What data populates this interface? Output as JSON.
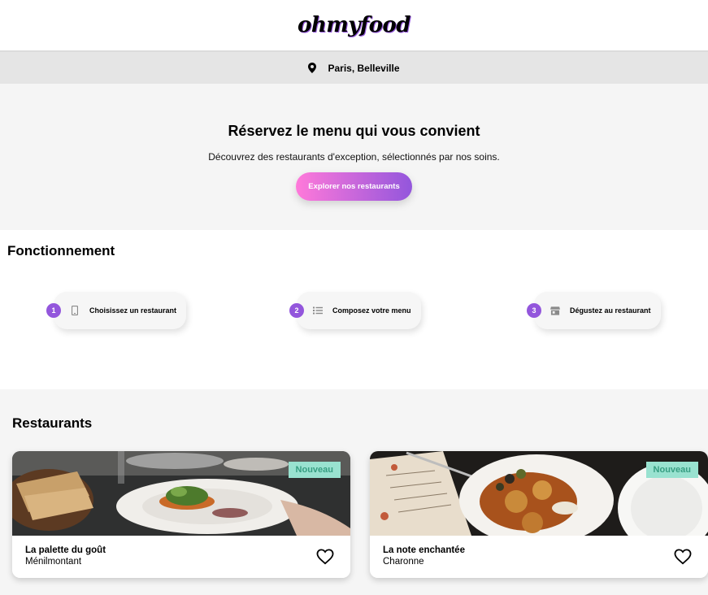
{
  "header": {
    "logo_text": "ohmyfood"
  },
  "location": {
    "icon": "map-pin-icon",
    "text": "Paris, Belleville"
  },
  "hero": {
    "title": "Réservez le menu qui vous convient",
    "subtitle": "Découvrez des restaurants d'exception, sélectionnés par nos soins.",
    "cta_label": "Explorer nos restaurants"
  },
  "how": {
    "title": "Fonctionnement",
    "steps": [
      {
        "number": "1",
        "icon": "mobile-phone-icon",
        "label": "Choisissez un restaurant"
      },
      {
        "number": "2",
        "icon": "list-icon",
        "label": "Composez votre menu"
      },
      {
        "number": "3",
        "icon": "store-icon",
        "label": "Dégustez au restaurant"
      }
    ]
  },
  "restaurants": {
    "title": "Restaurants",
    "items": [
      {
        "name": "La palette du goût",
        "area": "Ménilmontant",
        "badge": "Nouveau",
        "icon": "heart-outline-icon"
      },
      {
        "name": "La note enchantée",
        "area": "Charonne",
        "badge": "Nouveau",
        "icon": "heart-outline-icon"
      }
    ]
  },
  "colors": {
    "primary": "#9356dc",
    "secondary": "#ff79da",
    "tertiary": "#99e2d0",
    "background": "#f5f5f5"
  }
}
